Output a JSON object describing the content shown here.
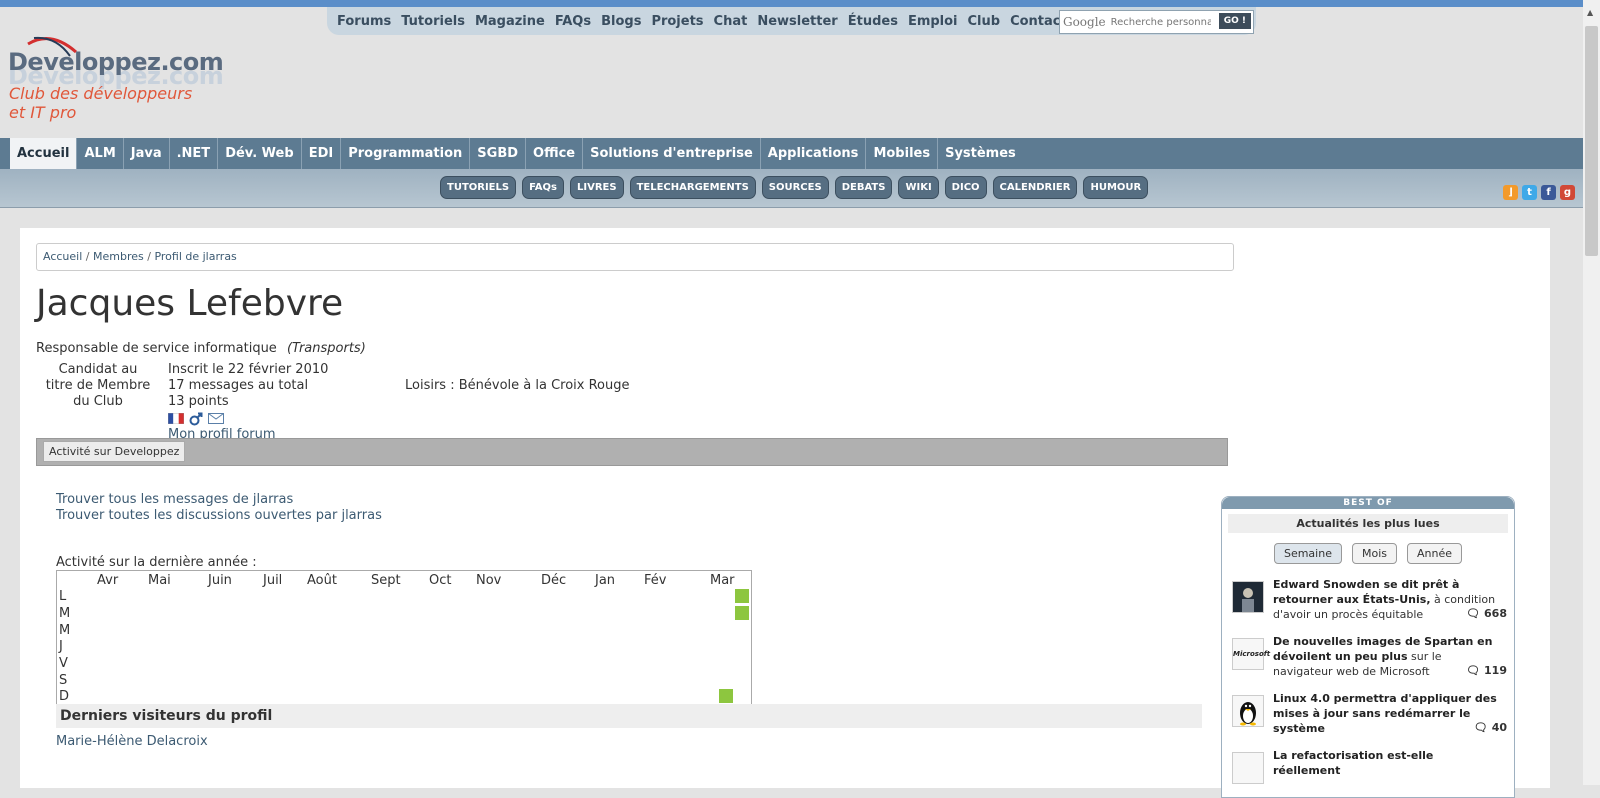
{
  "top_nav": {
    "links": [
      "Forums",
      "Tutoriels",
      "Magazine",
      "FAQs",
      "Blogs",
      "Projets",
      "Chat",
      "Newsletter",
      "Études",
      "Emploi",
      "Club",
      "Contacts"
    ],
    "search_placeholder": "Recherche personnali",
    "search_go": "GO !",
    "google_label": "Google"
  },
  "logo": {
    "brand": "Developpez.com",
    "tagline1": "Club des développeurs",
    "tagline2": "et IT pro"
  },
  "main_nav": [
    "Accueil",
    "ALM",
    "Java",
    ".NET",
    "Dév. Web",
    "EDI",
    "Programmation",
    "SGBD",
    "Office",
    "Solutions d'entreprise",
    "Applications",
    "Mobiles",
    "Systèmes"
  ],
  "sub_nav": [
    "TUTORIELS",
    "FAQs",
    "LIVRES",
    "TELECHARGEMENTS",
    "SOURCES",
    "DEBATS",
    "WIKI",
    "DICO",
    "CALENDRIER",
    "HUMOUR"
  ],
  "breadcrumb": [
    "Accueil",
    "Membres",
    "Profil de jlarras"
  ],
  "profile": {
    "name": "Jacques Lefebvre",
    "job": "Responsable de service informatique",
    "sector": "(Transports)",
    "candidat": "Candidat au titre de Membre du Club",
    "registered": "Inscrit le 22 février 2010",
    "messages": "17 messages au total",
    "points": "13 points",
    "forum_link": "Mon profil forum",
    "loisirs": "Loisirs : Bénévole à la Croix Rouge"
  },
  "tab": "Activité sur Developpez",
  "links": [
    "Trouver tous les messages de jlarras",
    "Trouver toutes les discussions ouvertes par jlarras"
  ],
  "activity": {
    "title": "Activité sur la dernière année :",
    "months": [
      "Avr",
      "Mai",
      "Juin",
      "Juil",
      "Août",
      "Sept",
      "Oct",
      "Nov",
      "Déc",
      "Jan",
      "Fév",
      "Mar"
    ],
    "days": [
      "L",
      "M",
      "M",
      "J",
      "V",
      "S",
      "D"
    ]
  },
  "visitors": {
    "title": "Derniers visiteurs du profil",
    "names": [
      "Marie-Hélène Delacroix"
    ]
  },
  "bestof": {
    "header": "BEST OF",
    "subtitle": "Actualités les plus lues",
    "periods": [
      "Semaine",
      "Mois",
      "Année"
    ],
    "items": [
      {
        "title": "Edward Snowden se dit prêt à retourner aux États-Unis,",
        "rest": " à condition d'avoir un procès équitable",
        "count": "668"
      },
      {
        "title": "De nouvelles images de Spartan en dévoilent un peu plus",
        "rest": " sur le navigateur web de Microsoft",
        "count": "119",
        "thumb": "Microsoft"
      },
      {
        "title": "Linux 4.0 permettra d'appliquer des mises à jour sans redémarrer le système",
        "rest": "",
        "count": "40"
      },
      {
        "title": "La refactorisation est-elle réellement",
        "rest": "",
        "count": ""
      }
    ]
  },
  "colors": {
    "accent": "#5d7b92",
    "heat": "#8dc63f",
    "link": "#3c5a72",
    "logo_orange": "#e0573a"
  }
}
